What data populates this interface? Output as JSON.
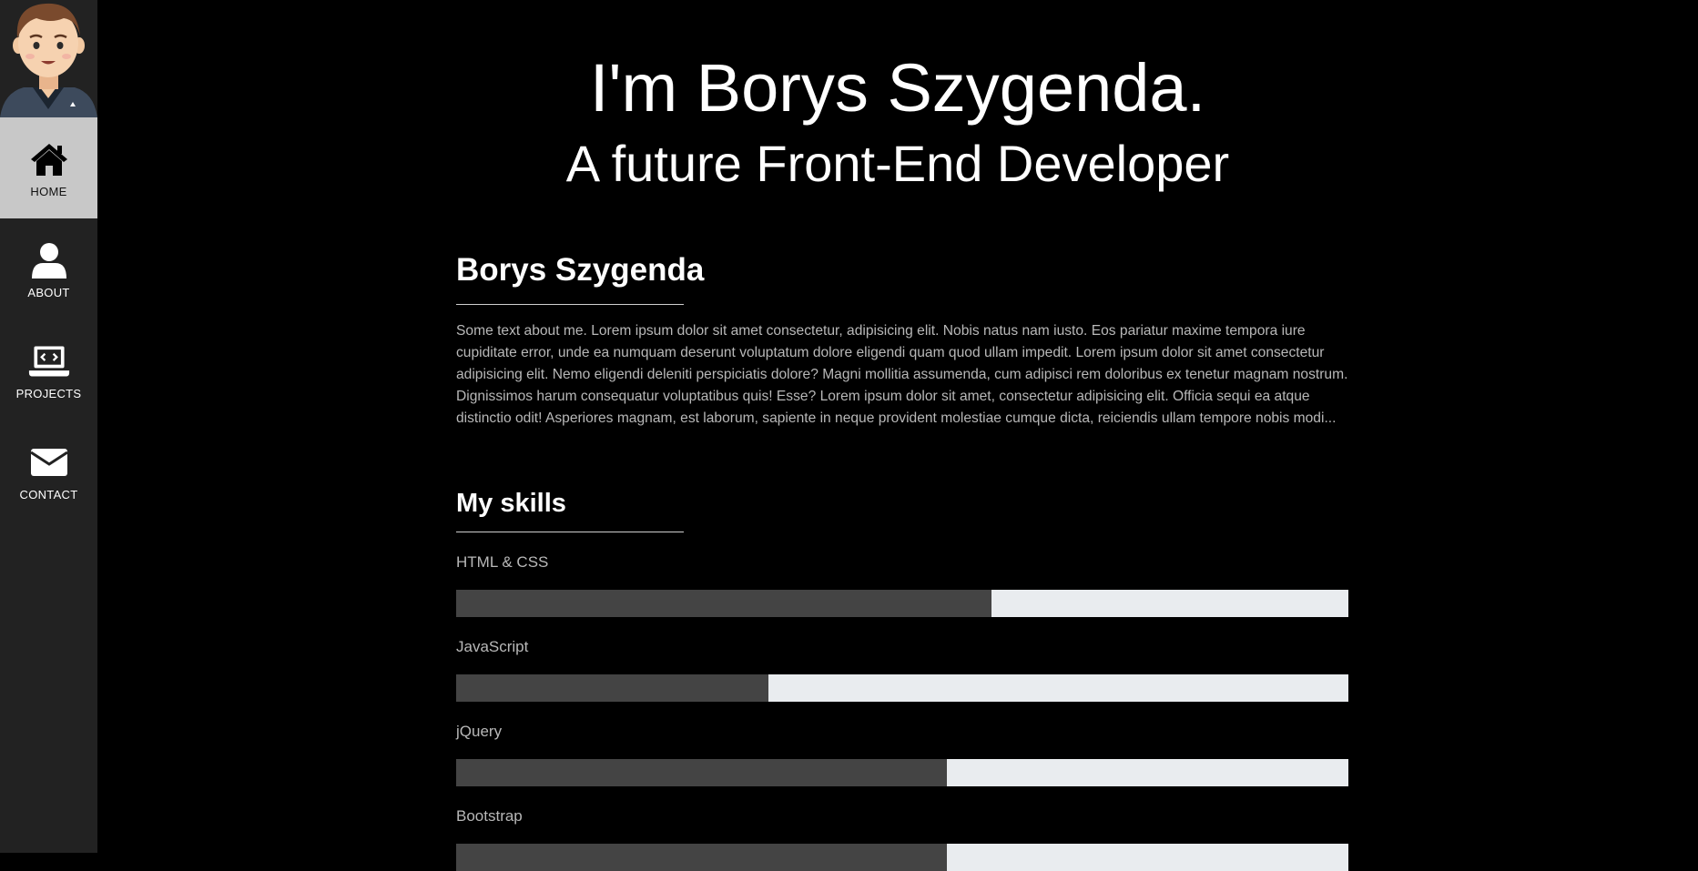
{
  "sidebar": {
    "avatar_alt": "avatar",
    "items": [
      {
        "label": "HOME",
        "icon": "home-icon",
        "active": true
      },
      {
        "label": "ABOUT",
        "icon": "user-icon",
        "active": false
      },
      {
        "label": "PROJECTS",
        "icon": "laptop-code-icon",
        "active": false
      },
      {
        "label": "CONTACT",
        "icon": "envelope-icon",
        "active": false
      }
    ]
  },
  "hero": {
    "title": "I'm Borys Szygenda.",
    "subtitle": "A future Front-End Developer"
  },
  "about": {
    "heading": "Borys Szygenda",
    "text": "Some text about me. Lorem ipsum dolor sit amet consectetur, adipisicing elit. Nobis natus nam iusto. Eos pariatur maxime tempora iure cupiditate error, unde ea numquam deserunt voluptatum dolore eligendi quam quod ullam impedit. Lorem ipsum dolor sit amet consectetur adipisicing elit. Nemo eligendi deleniti perspiciatis dolore? Magni mollitia assumenda, cum adipisci rem doloribus ex tenetur magnam nostrum. Dignissimos harum consequatur voluptatibus quis! Esse? Lorem ipsum dolor sit amet, consectetur adipisicing elit. Officia sequi ea atque distinctio odit! Asperiores magnam, est laborum, sapiente in neque provident molestiae cumque dicta, reiciendis ullam tempore nobis modi..."
  },
  "skills": {
    "heading": "My skills",
    "items": [
      {
        "name": "HTML & CSS",
        "level": 0.6
      },
      {
        "name": "JavaScript",
        "level": 0.35
      },
      {
        "name": "jQuery",
        "level": 0.55
      },
      {
        "name": "Bootstrap",
        "level": 0.55
      }
    ]
  },
  "colors": {
    "background": "#000000",
    "sidebar": "#222222",
    "sidebar_active": "#c8c8c8",
    "bar_fill": "#444444",
    "bar_track": "#e9ecef"
  }
}
